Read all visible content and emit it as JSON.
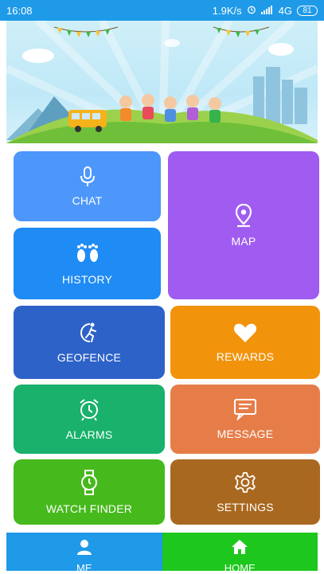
{
  "status_bar": {
    "time": "16:08",
    "net_speed": "1.9K/s",
    "signal_text": "4G",
    "battery": "81"
  },
  "tiles": {
    "chat": {
      "label": "CHAT",
      "icon": "microphone-icon",
      "color": "#4d97fb"
    },
    "history": {
      "label": "HISTORY",
      "icon": "footprints-icon",
      "color": "#1f8bf4"
    },
    "map": {
      "label": "MAP",
      "icon": "map-pin-icon",
      "color": "#a05cf0"
    },
    "geofence": {
      "label": "GEOFENCE",
      "icon": "geofence-runner-icon",
      "color": "#2d62c8"
    },
    "rewards": {
      "label": "REWARDS",
      "icon": "heart-icon",
      "color": "#f2930c"
    },
    "alarms": {
      "label": "ALARMS",
      "icon": "alarm-clock-icon",
      "color": "#19b16b"
    },
    "message": {
      "label": "MESSAGE",
      "icon": "message-icon",
      "color": "#e67d49"
    },
    "watch_finder": {
      "label": "WATCH FINDER",
      "icon": "watch-icon",
      "color": "#46b91c"
    },
    "settings": {
      "label": "SETTINGS",
      "icon": "gear-icon",
      "color": "#a9681f"
    }
  },
  "nav": {
    "me": {
      "label": "ME",
      "icon": "person-icon",
      "color": "#1e9ae8"
    },
    "home": {
      "label": "HOME",
      "icon": "home-icon",
      "color": "#1ec71e"
    }
  }
}
